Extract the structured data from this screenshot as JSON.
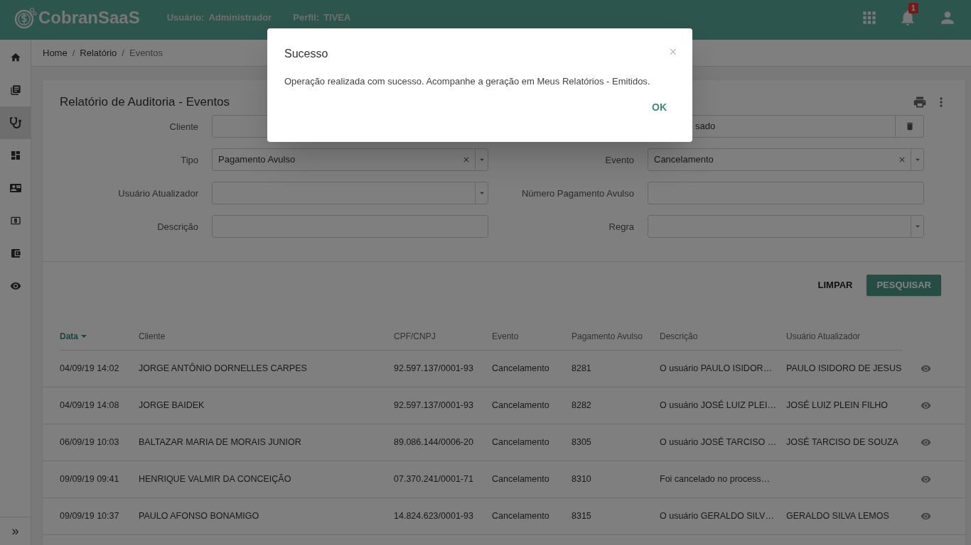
{
  "header": {
    "logo": "CobranSaaS",
    "user_label": "Usuário:",
    "user_value": "Administrador",
    "profile_label": "Perfil:",
    "profile_value": "TIVEA",
    "notifications": "1"
  },
  "sidebar": {
    "items": [
      {
        "kind": "home",
        "selected": false
      },
      {
        "kind": "library",
        "selected": false
      },
      {
        "kind": "stethoscope",
        "selected": true
      },
      {
        "kind": "dashboard",
        "selected": false
      },
      {
        "kind": "contact",
        "selected": false
      },
      {
        "kind": "money",
        "selected": false
      },
      {
        "kind": "wallet",
        "selected": false
      },
      {
        "kind": "eye",
        "selected": false
      }
    ],
    "expand": "»"
  },
  "breadcrumb_separator": "/",
  "breadcrumb": [
    {
      "label": "Home",
      "current": false
    },
    {
      "label": "Relatório",
      "current": false
    },
    {
      "label": "Eventos",
      "current": true
    }
  ],
  "card": {
    "title": "Relatório de Auditoria - Eventos",
    "filters": [
      {
        "label": "Cliente",
        "kind": "text"
      },
      {
        "kind": "lookup",
        "value": "sado"
      },
      {
        "label": "Tipo",
        "kind": "select",
        "value": "Pagamento Avulso",
        "clearable": true
      },
      {
        "label": "Evento",
        "kind": "select",
        "value": "Cancelamento",
        "clearable": true
      },
      {
        "label": "Usuário Atualizador",
        "kind": "select",
        "clearable": false
      },
      {
        "label": "Número Pagamento Avulso",
        "kind": "text"
      },
      {
        "label": "Descrição",
        "kind": "text"
      },
      {
        "label": "Regra",
        "kind": "select",
        "clearable": false
      }
    ],
    "clear_button": "LIMPAR",
    "search_button": "PESQUISAR"
  },
  "table": {
    "columns": [
      {
        "label": "Data",
        "sorted": true
      },
      {
        "label": "Cliente",
        "sorted": false
      },
      {
        "label": "CPF/CNPJ",
        "sorted": false
      },
      {
        "label": "Evento",
        "sorted": false
      },
      {
        "label": "Pagamento Avulso",
        "sorted": false
      },
      {
        "label": "Descrição",
        "sorted": false
      },
      {
        "label": "Usuário Atualizador",
        "sorted": false
      }
    ],
    "rows": [
      [
        "04/09/19 14:02",
        "JORGE ANTÔNIO DORNELLES CARPES",
        "92.597.137/0001-93",
        "Cancelamento",
        "8281",
        "O usuário PAULO ISIDOR…",
        "PAULO ISIDORO DE JESUS"
      ],
      [
        "04/09/19 14:08",
        "JORGE BAIDEK",
        "92.597.137/0001-93",
        "Cancelamento",
        "8282",
        "O usuário JOSÉ LUIZ PLEI…",
        "JOSÉ LUIZ PLEIN FILHO"
      ],
      [
        "06/09/19 10:03",
        "BALTAZAR MARIA DE MORAIS JUNIOR",
        "89.086.144/0006-20",
        "Cancelamento",
        "8305",
        "O usuário JOSÉ TARCISO …",
        "JOSÉ TARCISO DE SOUZA"
      ],
      [
        "09/09/19 09:41",
        "HENRIQUE VALMIR DA CONCEIÇÃO",
        "07.370.241/0001-71",
        "Cancelamento",
        "8310",
        "Foi cancelado no process…",
        ""
      ],
      [
        "09/09/19 10:37",
        "PAULO AFONSO BONAMIGO",
        "14.824.623/0001-93",
        "Cancelamento",
        "8315",
        "O usuário GERALDO SILV…",
        "GERALDO SILVA LEMOS"
      ]
    ]
  },
  "modal": {
    "title": "Sucesso",
    "close": "×",
    "message": "Operação realizada com sucesso. Acompanhe a geração em Meus Relatórios - Emitidos.",
    "ok": "OK"
  }
}
